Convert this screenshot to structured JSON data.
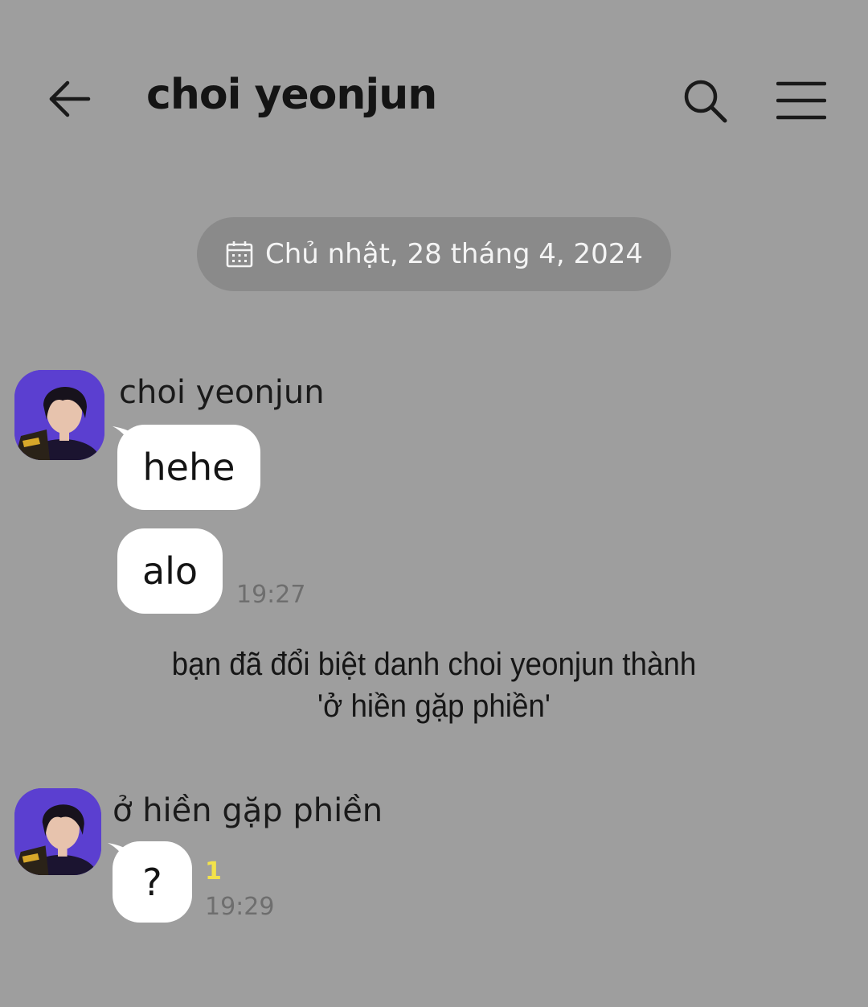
{
  "header": {
    "title": "choi yeonjun",
    "back_icon": "arrow-left-icon",
    "search_icon": "search-icon",
    "menu_icon": "hamburger-menu-icon"
  },
  "date_separator": {
    "icon": "calendar-icon",
    "text": "Chủ nhật, 28 tháng 4, 2024"
  },
  "messages": [
    {
      "sender": "choi yeonjun",
      "bubbles": [
        "hehe",
        "alo"
      ],
      "time": "19:27"
    },
    {
      "sender": "ở hiền gặp phiền",
      "bubbles": [
        "?"
      ],
      "unread_count": "1",
      "time": "19:29"
    }
  ],
  "system_note": {
    "line1": "bạn đã đổi biệt danh choi yeonjun thành",
    "line2": "'ở hiền gặp phiền'"
  },
  "colors": {
    "background": "#9e9e9e",
    "bubble": "#ffffff",
    "date_pill": "#8a8a8a",
    "unread": "#f3e34a",
    "avatar_bg": "#5b3fd0"
  }
}
